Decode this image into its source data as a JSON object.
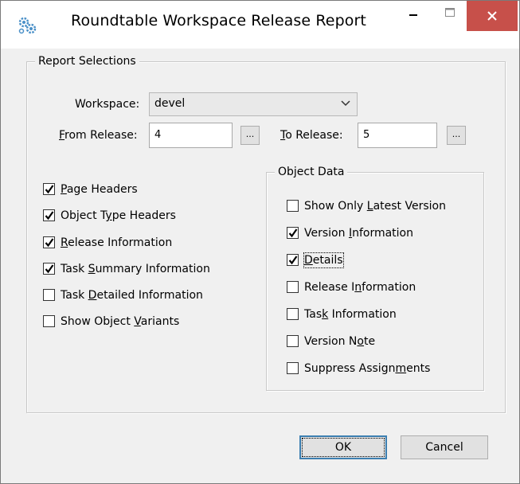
{
  "window": {
    "title": "Roundtable Workspace Release Report"
  },
  "report_selections": {
    "legend": "Report Selections",
    "workspace_label": "Workspace:",
    "workspace_value": "devel",
    "from_release_label_u": "F",
    "from_release_label_rest": "rom Release:",
    "from_release_value": "4",
    "to_release_label_u": "T",
    "to_release_label_rest": "o Release:",
    "to_release_value": "5",
    "browse_label": "..."
  },
  "left_options": [
    {
      "pre": "",
      "u": "P",
      "post": "age Headers",
      "checked": true
    },
    {
      "pre": "Object T",
      "u": "y",
      "post": "pe Headers",
      "checked": true
    },
    {
      "pre": "",
      "u": "R",
      "post": "elease Information",
      "checked": true
    },
    {
      "pre": "Task ",
      "u": "S",
      "post": "ummary Information",
      "checked": true
    },
    {
      "pre": "Task ",
      "u": "D",
      "post": "etailed Information",
      "checked": false
    },
    {
      "pre": "Show Object ",
      "u": "V",
      "post": "ariants",
      "checked": false
    }
  ],
  "object_data": {
    "legend": "Object Data",
    "options": [
      {
        "pre": "Show Only ",
        "u": "L",
        "post": "atest Version",
        "checked": false
      },
      {
        "pre": "Version ",
        "u": "I",
        "post": "nformation",
        "checked": true
      },
      {
        "pre": "",
        "u": "D",
        "post": "etails",
        "checked": true
      },
      {
        "pre": "Release I",
        "u": "n",
        "post": "formation",
        "checked": false
      },
      {
        "pre": "Tas",
        "u": "k",
        "post": " Information",
        "checked": false
      },
      {
        "pre": "Version N",
        "u": "o",
        "post": "te",
        "checked": false
      },
      {
        "pre": "Suppress Assign",
        "u": "m",
        "post": "ents",
        "checked": false
      }
    ]
  },
  "buttons": {
    "ok_label": "OK",
    "cancel_label": "Cancel"
  },
  "colors": {
    "close_button": "#c7504a",
    "dialog_background": "#f0f0f0",
    "default_button_border": "#3c7fb1"
  },
  "icons": {
    "app": "gears-icon",
    "minimize": "minimize-icon",
    "maximize": "maximize-icon",
    "close": "close-icon",
    "dropdown": "chevron-down-icon",
    "check": "checkmark-icon"
  }
}
